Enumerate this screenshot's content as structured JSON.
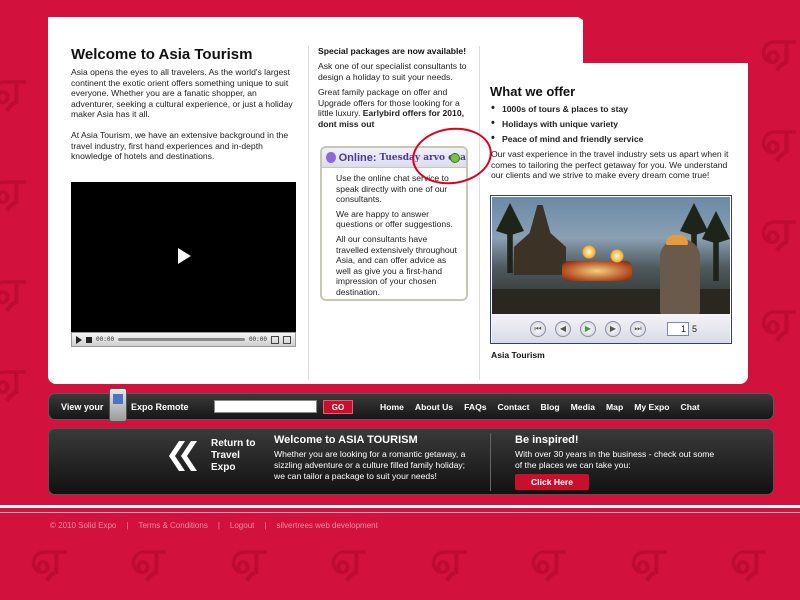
{
  "main": {
    "welcome_title": "Welcome to Asia Tourism",
    "welcome_p1": "Asia opens the eyes to all travelers. As the world's largest continent the exotic orient offers something unique to suit everyone. Whether you are a fanatic shopper, an adventurer, seeking a cultural experience, or just a holiday maker Asia has it all.",
    "welcome_p2": "At Asia Tourism, we have an extensive background in the travel industry, first hand experiences and in-depth knowledge of hotels and destinations.",
    "video": {
      "time_current": "00:00",
      "time_total": "00:00"
    }
  },
  "packages": {
    "title": "Special packages are now available!",
    "p1": "Ask one of our specialist consultants to design a holiday to suit your needs.",
    "p2": "Great family package on offer and Upgrade offers for those looking for a little luxury.",
    "p2_bold": "Earlybird offers for 2010, dont miss out"
  },
  "chat": {
    "status": "Online:",
    "day": "Tuesday arvo cha",
    "p1": "Use the online chat service to speak directly with one of our consultants.",
    "p2": "We are happy to answer questions or offer suggestions.",
    "p3": "All our consultants have travelled extensively throughout Asia, and can offer advice as well as give you a first-hand impression of your chosen destination."
  },
  "offer": {
    "title": "What we offer",
    "items": [
      "1000s of tours & places to stay",
      "Holidays with unique variety",
      "Peace of mind and friendly service"
    ],
    "p": "Our vast experience in the travel industry sets us apart when it comes to tailoring the perfect getaway for you. We understand our clients and we strive to make every dream come true!",
    "slideshow": {
      "current": "1",
      "total": "5"
    },
    "caption": "Asia Tourism"
  },
  "nav": {
    "view_your": "View your",
    "expo_remote": "Expo Remote",
    "go": "GO",
    "links": [
      "Home",
      "About Us",
      "FAQs",
      "Contact",
      "Blog",
      "Media",
      "Map",
      "My Expo",
      "Chat"
    ]
  },
  "promo": {
    "return_text": "Return to Travel Expo",
    "title": "Welcome to ASIA TOURISM",
    "p": "Whether you are looking for a romantic getaway, a sizzling adventure or a culture filled family holiday; we can tailor a package to suit your needs!",
    "inspired_title": "Be inspired!",
    "inspired_p": "With over 30 years in the business - check out some of the places we can take you:",
    "click_here": "Click Here"
  },
  "footer": {
    "copyright": "© 2010 Solid Expo",
    "terms": "Terms & Conditions",
    "logout": "Logout",
    "credit": "silvertrees web development",
    "sep": "|"
  },
  "colors": {
    "brand_red": "#d2123d",
    "button_red": "#c8102e",
    "annotation_red": "#e0001b"
  }
}
